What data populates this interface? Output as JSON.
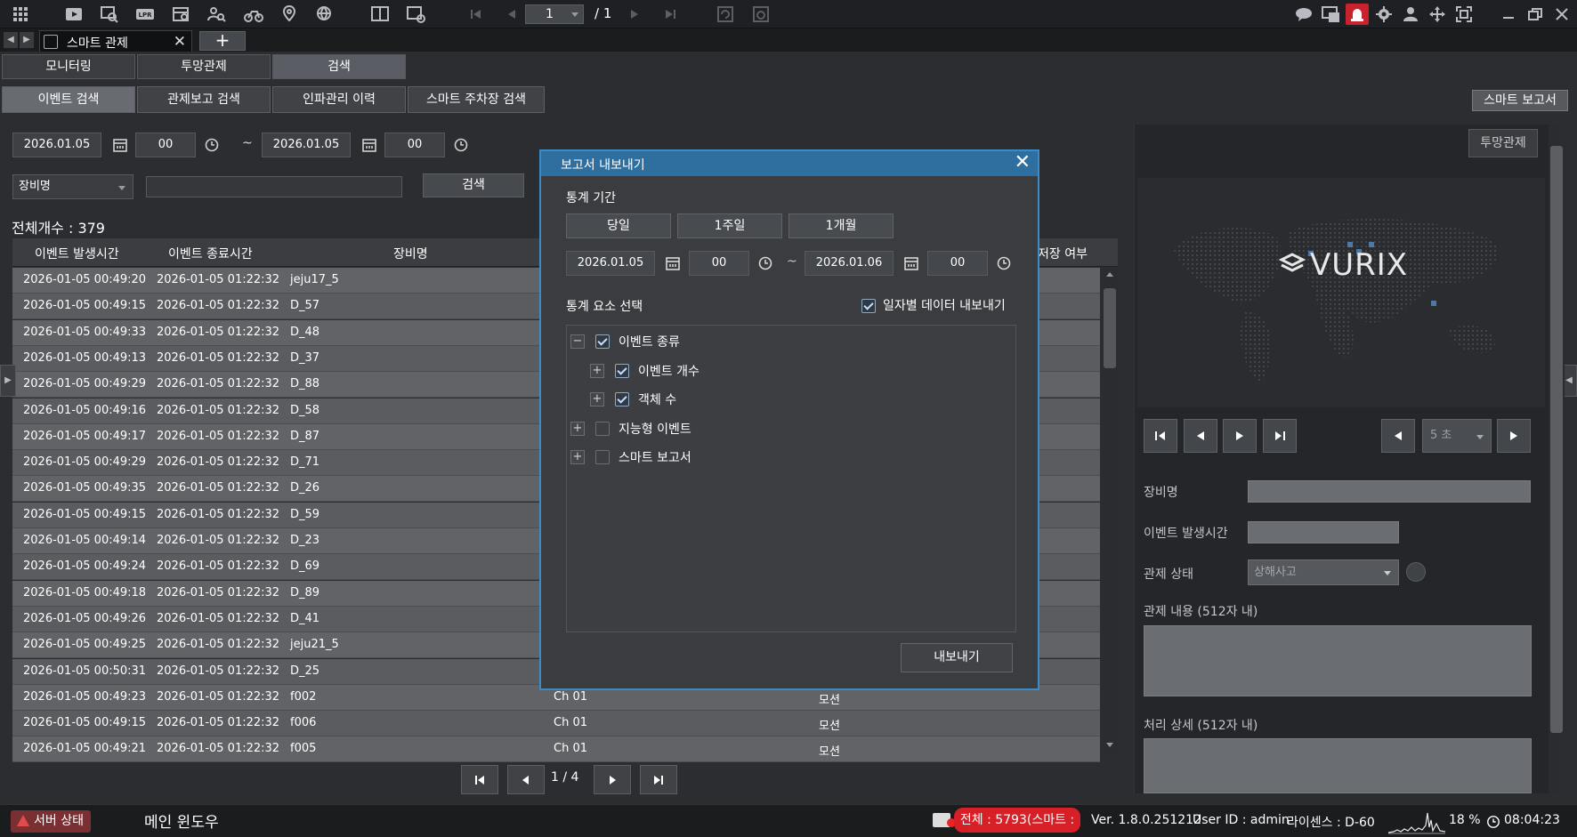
{
  "toolbar": {
    "page_current": "1",
    "page_total": "/ 1",
    "icons_left": [
      "grid-menu-icon",
      "play-video-icon",
      "search-camera-icon",
      "lpr-icon",
      "calendar-device-icon",
      "people-search-icon",
      "bike-icon",
      "map-search-icon",
      "globe-search-icon",
      "split-screen-icon",
      "add-screen-icon"
    ],
    "icons_right": [
      "chat-icon",
      "message-screen-icon",
      "alarm-icon",
      "gear-icon",
      "user-icon",
      "move-icon",
      "fullscreen-icon",
      "minimize-icon",
      "restore-icon",
      "close-icon"
    ]
  },
  "tabbar": {
    "doc_tab_label": "스마트 관제",
    "close": "✕",
    "add": "+"
  },
  "main_tabs": [
    "모니터링",
    "투망관제",
    "검색"
  ],
  "sub_tabs": [
    "이벤트 검색",
    "관제보고 검색",
    "인파관리 이력",
    "스마트 주차장 검색"
  ],
  "smart_report_button": "스마트 보고서",
  "search": {
    "start_date": "2026.01.05",
    "start_hour": "00",
    "tilde": "~",
    "end_date": "2026.01.05",
    "end_hour": "00",
    "device_filter": "장비명",
    "keyword_value": "",
    "search_button": "검색"
  },
  "total_count": "전체개수 : 379",
  "table": {
    "headers": [
      "이벤트 발생시간",
      "이벤트 종료시간",
      "장비명",
      "저장 여부"
    ],
    "rows": [
      [
        "2026-01-05 00:49:20",
        "2026-01-05 01:22:32",
        "jeju17_5",
        "",
        ""
      ],
      [
        "2026-01-05 00:49:15",
        "2026-01-05 01:22:32",
        "D_57",
        "",
        ""
      ],
      [
        "2026-01-05 00:49:33",
        "2026-01-05 01:22:32",
        "D_48",
        "",
        ""
      ],
      [
        "2026-01-05 00:49:13",
        "2026-01-05 01:22:32",
        "D_37",
        "",
        ""
      ],
      [
        "2026-01-05 00:49:29",
        "2026-01-05 01:22:32",
        "D_88",
        "",
        ""
      ],
      [
        "2026-01-05 00:49:16",
        "2026-01-05 01:22:32",
        "D_58",
        "",
        ""
      ],
      [
        "2026-01-05 00:49:17",
        "2026-01-05 01:22:32",
        "D_87",
        "",
        ""
      ],
      [
        "2026-01-05 00:49:29",
        "2026-01-05 01:22:32",
        "D_71",
        "",
        ""
      ],
      [
        "2026-01-05 00:49:35",
        "2026-01-05 01:22:32",
        "D_26",
        "",
        ""
      ],
      [
        "2026-01-05 00:49:15",
        "2026-01-05 01:22:32",
        "D_59",
        "",
        ""
      ],
      [
        "2026-01-05 00:49:14",
        "2026-01-05 01:22:32",
        "D_23",
        "",
        ""
      ],
      [
        "2026-01-05 00:49:24",
        "2026-01-05 01:22:32",
        "D_69",
        "",
        ""
      ],
      [
        "2026-01-05 00:49:18",
        "2026-01-05 01:22:32",
        "D_89",
        "",
        ""
      ],
      [
        "2026-01-05 00:49:26",
        "2026-01-05 01:22:32",
        "D_41",
        "",
        ""
      ],
      [
        "2026-01-05 00:49:25",
        "2026-01-05 01:22:32",
        "jeju21_5",
        "",
        ""
      ],
      [
        "2026-01-05 00:50:31",
        "2026-01-05 01:22:32",
        "D_25",
        "",
        ""
      ],
      [
        "2026-01-05 00:49:23",
        "2026-01-05 01:22:32",
        "f002",
        "Ch 01",
        "모션"
      ],
      [
        "2026-01-05 00:49:15",
        "2026-01-05 01:22:32",
        "f006",
        "Ch 01",
        "모션"
      ],
      [
        "2026-01-05 00:49:21",
        "2026-01-05 01:22:32",
        "f005",
        "Ch 01",
        "모션"
      ]
    ]
  },
  "pager": {
    "label": "1 / 4"
  },
  "right_panel": {
    "top_button": "투망관제",
    "logo_text": "VURIX",
    "interval_select": "5 초",
    "device_label": "장비명",
    "device_value": "",
    "event_time_label": "이벤트 발생시간",
    "event_time_value": "",
    "status_label": "관제 상태",
    "status_value": "상해사고",
    "content_label": "관제 내용 (512자 내)",
    "content_value": "",
    "detail_label": "처리 상세 (512자 내)",
    "detail_value": ""
  },
  "modal": {
    "title": "보고서 내보내기",
    "close": "✕",
    "period_label": "통계 기간",
    "period_buttons": [
      "당일",
      "1주일",
      "1개월"
    ],
    "start_date": "2026.01.05",
    "start_hour": "00",
    "tilde": "~",
    "end_date": "2026.01.06",
    "end_hour": "00",
    "element_label": "통계 요소 선택",
    "daily_export_label": "일자별 데이터 내보내기",
    "daily_export_checked": true,
    "tree": [
      {
        "label": "이벤트 종류",
        "checked": true,
        "expanded": true,
        "level": 0
      },
      {
        "label": "이벤트 개수",
        "checked": true,
        "expanded": false,
        "level": 1
      },
      {
        "label": "객체 수",
        "checked": true,
        "expanded": false,
        "level": 1
      },
      {
        "label": "지능형 이벤트",
        "checked": false,
        "expanded": false,
        "level": 0
      },
      {
        "label": "스마트 보고서",
        "checked": false,
        "expanded": false,
        "level": 0
      }
    ],
    "export_button": "내보내기"
  },
  "statusbar": {
    "server_status": "서버 상태",
    "main_window": "메인 윈도우",
    "total_badge": "전체 : 5793(스마트 : 0)",
    "version": "Ver. 1.8.0.251212",
    "user": "User ID : admin",
    "license": "라이센스 : D-60",
    "cpu": "18 %",
    "clock": "08:04:23"
  },
  "colors": {
    "accent": "#3b8bc9",
    "modal_header": "#2e6f9f",
    "alert_red": "#d61f26"
  }
}
